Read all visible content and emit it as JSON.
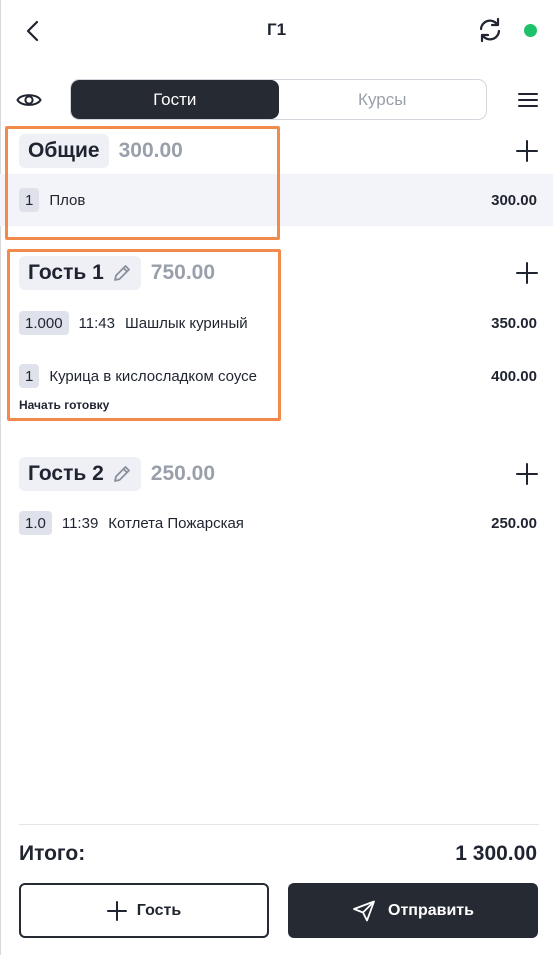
{
  "header": {
    "title": "Г1",
    "status_color": "#1ec26a"
  },
  "tabs": [
    {
      "label": "Гости",
      "active": true
    },
    {
      "label": "Курсы",
      "active": false
    }
  ],
  "groups": [
    {
      "name": "Общие",
      "total": "300.00",
      "editable": false,
      "items": [
        {
          "qty": "1",
          "time": "",
          "name": "Плов",
          "price": "300.00"
        }
      ]
    },
    {
      "name": "Гость 1",
      "total": "750.00",
      "editable": true,
      "items": [
        {
          "qty": "1.000",
          "time": "11:43",
          "name": "Шашлык куриный",
          "price": "350.00"
        },
        {
          "qty": "1",
          "time": "",
          "name": "Курица в кисло­сладком соусе",
          "price": "400.00",
          "action": "Начать готовку"
        }
      ]
    },
    {
      "name": "Гость 2",
      "total": "250.00",
      "editable": true,
      "items": [
        {
          "qty": "1.0",
          "time": "11:39",
          "name": "Котлета Пожарская",
          "price": "250.00"
        }
      ]
    }
  ],
  "footer": {
    "total_label": "Итого:",
    "total_value": "1 300.00",
    "add_guest_label": "Гость",
    "send_label": "Отправить"
  },
  "colors": {
    "accent_dark": "#262a33",
    "highlight_outline": "#f28a4b",
    "muted_text": "#9aa0ab",
    "online": "#1ec26a"
  }
}
